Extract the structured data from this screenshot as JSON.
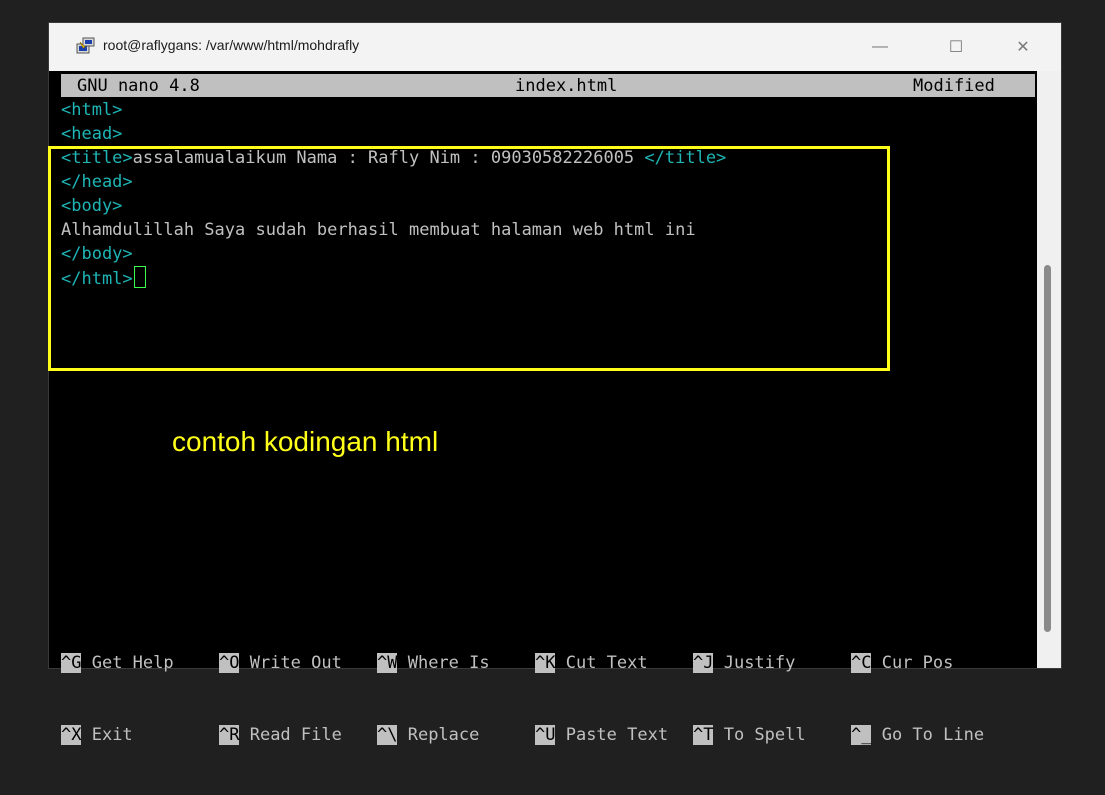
{
  "window": {
    "title": "root@raflygans: /var/www/html/mohdrafly",
    "minimize_glyph": "—",
    "maximize_glyph": "☐",
    "close_glyph": "✕",
    "icon": "putty-icon"
  },
  "nano": {
    "version": "GNU nano 4.8",
    "filename": "index.html",
    "status": "Modified"
  },
  "editor": {
    "lines": [
      {
        "parts": [
          {
            "t": "<html>",
            "k": "tag"
          }
        ]
      },
      {
        "parts": [
          {
            "t": "<head>",
            "k": "tag"
          }
        ]
      },
      {
        "parts": [
          {
            "t": "<title>",
            "k": "tag"
          },
          {
            "t": "assalamualaikum Nama : Rafly Nim : 09030582226005 ",
            "k": "txt"
          },
          {
            "t": "</title>",
            "k": "tag"
          }
        ]
      },
      {
        "parts": [
          {
            "t": "</head>",
            "k": "tag"
          }
        ]
      },
      {
        "parts": [
          {
            "t": "<body>",
            "k": "tag"
          }
        ]
      },
      {
        "parts": [
          {
            "t": "Alhamdulillah Saya sudah berhasil membuat halaman web html ini",
            "k": "txt"
          }
        ]
      },
      {
        "parts": [
          {
            "t": "</body>",
            "k": "tag"
          }
        ]
      },
      {
        "parts": [
          {
            "t": "</html>",
            "k": "tag"
          }
        ],
        "cursor": true
      }
    ]
  },
  "annotation": "contoh kodingan html",
  "shortcuts": {
    "row1": [
      {
        "key": "^G",
        "label": "Get Help"
      },
      {
        "key": "^O",
        "label": "Write Out"
      },
      {
        "key": "^W",
        "label": "Where Is"
      },
      {
        "key": "^K",
        "label": "Cut Text"
      },
      {
        "key": "^J",
        "label": "Justify"
      },
      {
        "key": "^C",
        "label": "Cur Pos"
      }
    ],
    "row2": [
      {
        "key": "^X",
        "label": "Exit"
      },
      {
        "key": "^R",
        "label": "Read File"
      },
      {
        "key": "^\\",
        "label": "Replace"
      },
      {
        "key": "^U",
        "label": "Paste Text"
      },
      {
        "key": "^T",
        "label": "To Spell"
      },
      {
        "key": "^_",
        "label": "Go To Line"
      }
    ]
  },
  "colors": {
    "highlight": "#ffff1a",
    "tag": "#1fb5b5",
    "text": "#c0c0c0",
    "cursor": "#39ff4b"
  }
}
